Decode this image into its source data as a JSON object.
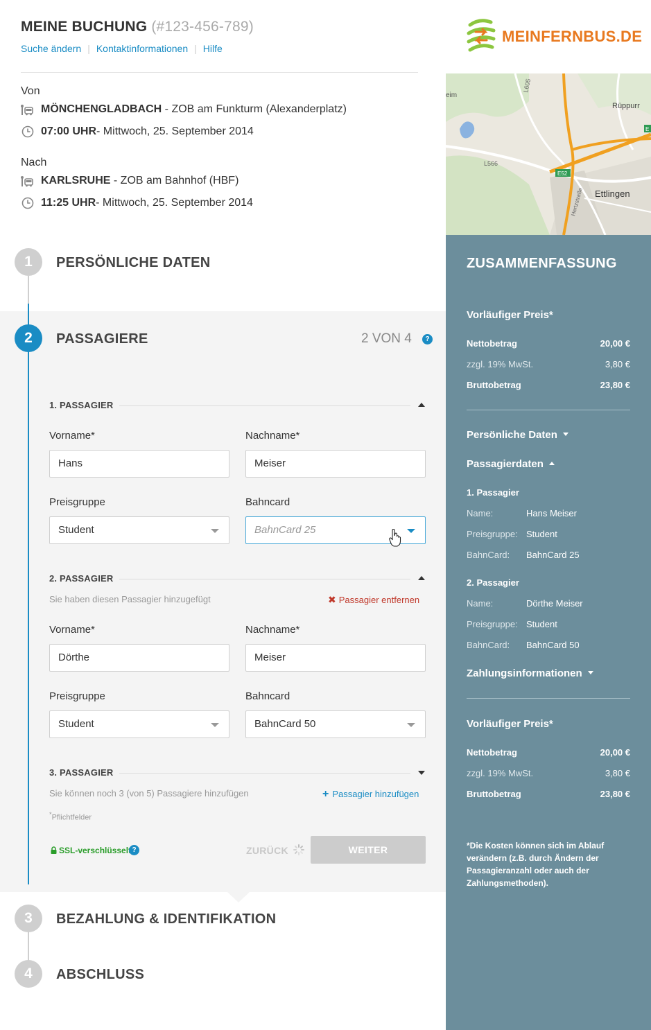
{
  "header": {
    "title": "MEINE BUCHUNG",
    "booking_number": "(#123-456-789)",
    "links": [
      "Suche ändern",
      "Kontaktinformationen",
      "Hilfe"
    ]
  },
  "route": {
    "from_label": "Von",
    "from_city": "MÖNCHENGLADBACH",
    "from_stop": " - ZOB am Funkturm (Alexanderplatz)",
    "from_time": "07:00 UHR",
    "from_date": "- Mittwoch, 25. September 2014",
    "to_label": "Nach",
    "to_city": "KARLSRUHE",
    "to_stop": " - ZOB am Bahnhof (HBF)",
    "to_time": "11:25 UHR",
    "to_date": "- Mittwoch, 25. September 2014"
  },
  "logo": {
    "text": "MEINFERNBUS.DE"
  },
  "map_labels": {
    "a": "L605",
    "b": "eim",
    "c": "Rüppurr",
    "d": "L566",
    "e": "E52",
    "f": "Ettlingen",
    "g": "Hertzstraße",
    "h": "E"
  },
  "steps": [
    {
      "number": "1",
      "title": "PERSÖNLICHE DATEN"
    },
    {
      "number": "2",
      "title": "PASSAGIERE"
    },
    {
      "number": "3",
      "title": "BEZAHLUNG & IDENTIFIKATION"
    },
    {
      "number": "4",
      "title": "ABSCHLUSS"
    }
  ],
  "passengers_step": {
    "counter": "2 VON 4",
    "help": "?",
    "labels": {
      "first_name": "Vorname*",
      "last_name": "Nachname*",
      "price_group": "Preisgruppe",
      "bahncard": "Bahncard"
    },
    "p1": {
      "heading": "1. PASSAGIER",
      "first_name": "Hans",
      "last_name": "Meiser",
      "price_group": "Student",
      "bahncard_placeholder": "BahnCard 25"
    },
    "p2": {
      "heading": "2. PASSAGIER",
      "added_note": "Sie haben diesen Passagier hinzugefügt",
      "remove": "Passagier entfernen",
      "first_name": "Dörthe",
      "last_name": "Meiser",
      "price_group": "Student",
      "bahncard": "BahnCard 50"
    },
    "p3": {
      "heading": "3. PASSAGIER",
      "note": "Sie können noch 3 (von 5) Passagiere hinzufügen",
      "add": "Passagier hinzufügen"
    },
    "required": "Pflichtfelder",
    "ssl": "SSL-verschlüsselt",
    "back": "ZURÜCK",
    "next": "WEITER"
  },
  "summary": {
    "title": "ZUSAMMENFASSUNG",
    "price_heading": "Vorläufiger Preis*",
    "net_label": "Nettobetrag",
    "net_value": "20,00 €",
    "vat_label": "zzgl. 19% MwSt.",
    "vat_value": "3,80 €",
    "gross_label": "Bruttobetrag",
    "gross_value": "23,80 €",
    "personal": "Persönliche Daten",
    "passenger_data": "Passagierdaten",
    "p1_title": "1. Passagier",
    "p2_title": "2. Passagier",
    "name_label": "Name:",
    "group_label": "Preisgruppe:",
    "card_label": "BahnCard:",
    "p1_name": "Hans Meiser",
    "p1_group": "Student",
    "p1_card": "BahnCard 25",
    "p2_name": "Dörthe Meiser",
    "p2_group": "Student",
    "p2_card": "BahnCard 50",
    "payment": "Zahlungsinformationen",
    "note": "Die Kosten können sich im Ablauf verändern (z.B. durch Ändern der Passagieranzahl oder auch der Zahlungsmethoden)."
  },
  "colors": {
    "accent": "#1a8cc4",
    "sidebar": "#6c8e9c",
    "logo": "#e8791f",
    "remove": "#c0392b",
    "ssl": "#2a9d2a"
  }
}
